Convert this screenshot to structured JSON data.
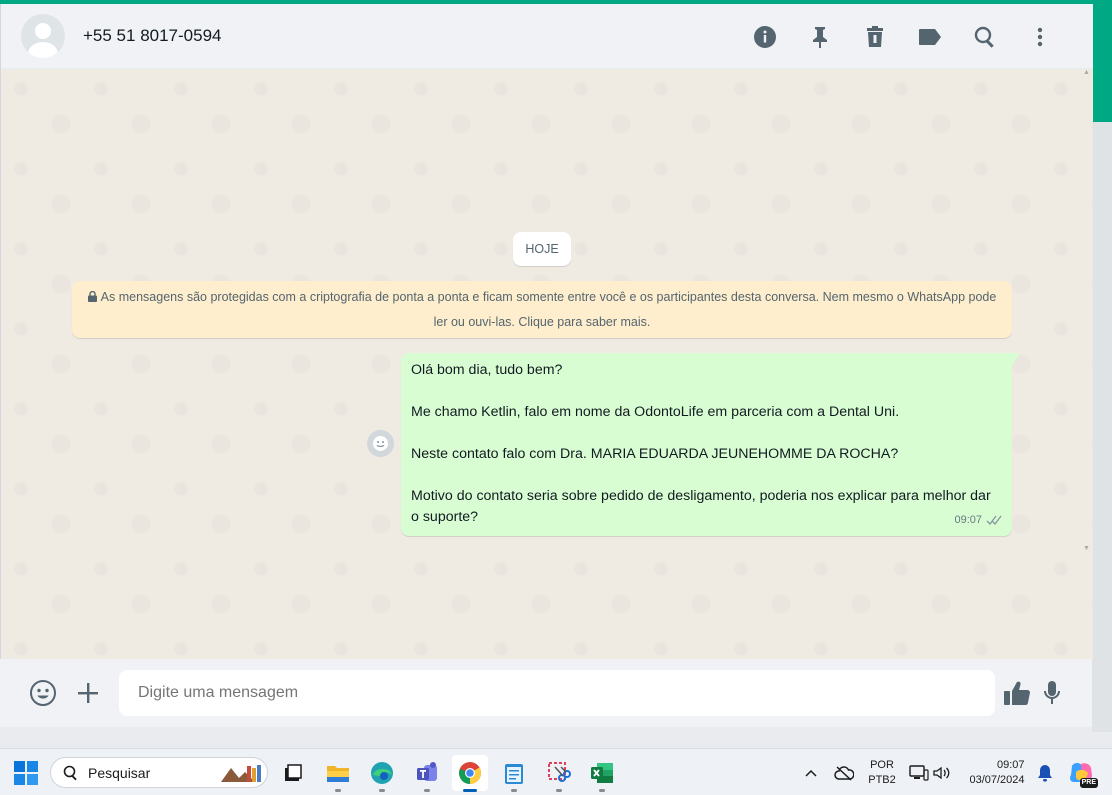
{
  "header": {
    "contact_name": "+55 51 8017-0594",
    "icons": [
      "info-icon",
      "pin-icon",
      "delete-icon",
      "label-icon",
      "search-icon",
      "menu-icon"
    ]
  },
  "chat": {
    "date_chip": "HOJE",
    "encryption_notice": "As mensagens são protegidas com a criptografia de ponta a ponta e ficam somente entre você e os participantes desta conversa. Nem mesmo o WhatsApp pode ler ou ouvi-las. Clique para saber mais.",
    "message": {
      "line1": "Olá bom dia, tudo bem?",
      "line2": "Me chamo Ketlin, falo em nome da OdontoLife em parceria com a Dental Uni.",
      "line3": "Neste contato falo com Dra. MARIA EDUARDA JEUNEHOMME DA ROCHA?",
      "line4": "Motivo do contato seria sobre pedido de desligamento, poderia nos explicar para melhor dar o suporte?",
      "time": "09:07",
      "status": "read"
    }
  },
  "composer": {
    "placeholder": "Digite uma mensagem"
  },
  "taskbar": {
    "search_label": "Pesquisar",
    "lang_top": "POR",
    "lang_bottom": "PTB2",
    "time": "09:07",
    "date": "03/07/2024",
    "badge": "PRE"
  },
  "colors": {
    "accent": "#00a884",
    "outgoing_bubble": "#d9fdd3",
    "notice_bg": "#ffeecd",
    "chat_bg": "#efeae2"
  }
}
